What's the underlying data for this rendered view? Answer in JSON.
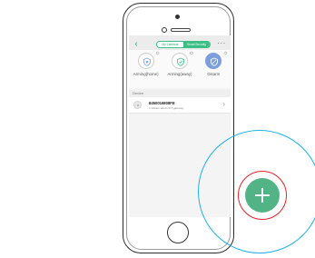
{
  "nav": {
    "segments": [
      "My Cameras",
      "Smart Security"
    ],
    "more_label": "···"
  },
  "modes": [
    {
      "label": "Arming(home)",
      "icon": "home-shield-icon",
      "active": false
    },
    {
      "label": "Arming(away)",
      "icon": "shield-icon",
      "active": false
    },
    {
      "label": "Disarm",
      "icon": "disarmed-shield-icon",
      "active": true
    }
  ],
  "devices_section": {
    "title": "Device",
    "items": [
      {
        "name": "8450016808FE",
        "subtitle": "1 Hidden alarm IOT gateway"
      }
    ]
  },
  "fab": {
    "icon": "plus-icon"
  },
  "colors": {
    "accent_green": "#3cbf87",
    "fab_green": "#52b486",
    "active_mode_blue": "#7c9edb",
    "highlight_red": "#e3232b",
    "zoom_blue": "#21b0e6"
  }
}
